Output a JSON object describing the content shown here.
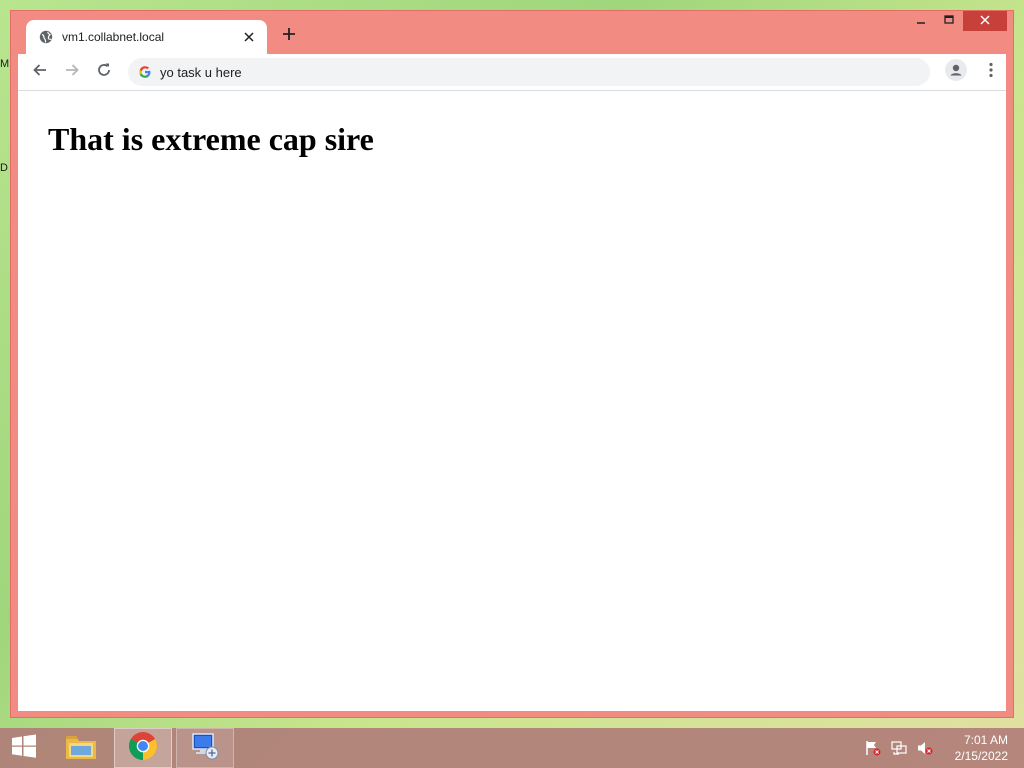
{
  "desktop": {
    "fragment_top": "M",
    "fragment_bottom": "D"
  },
  "browser": {
    "tab": {
      "title": "vm1.collabnet.local",
      "favicon": "globe-icon",
      "close_icon": "close-icon"
    },
    "new_tab_icon": "plus-icon",
    "window_controls": [
      "minimize-icon",
      "maximize-icon",
      "close-icon"
    ],
    "toolbar": {
      "back_icon": "arrow-left-icon",
      "forward_icon": "arrow-right-icon",
      "reload_icon": "reload-icon",
      "address_value": "yo task u here",
      "search_engine_icon": "google-g-icon",
      "profile_icon": "profile-icon",
      "menu_icon": "kebab-menu-icon"
    },
    "page": {
      "heading": "That is extreme cap sire"
    },
    "colors": {
      "frame": "#f28b82",
      "close_button": "#c7403a"
    }
  },
  "taskbar": {
    "items": [
      "windows-start-icon",
      "file-explorer-icon",
      "chrome-icon",
      "network-connection-icon"
    ],
    "tray": [
      "action-center-flag-icon",
      "network-icon",
      "volume-muted-icon"
    ],
    "clock": {
      "time": "7:01 AM",
      "date": "2/15/2022"
    }
  }
}
